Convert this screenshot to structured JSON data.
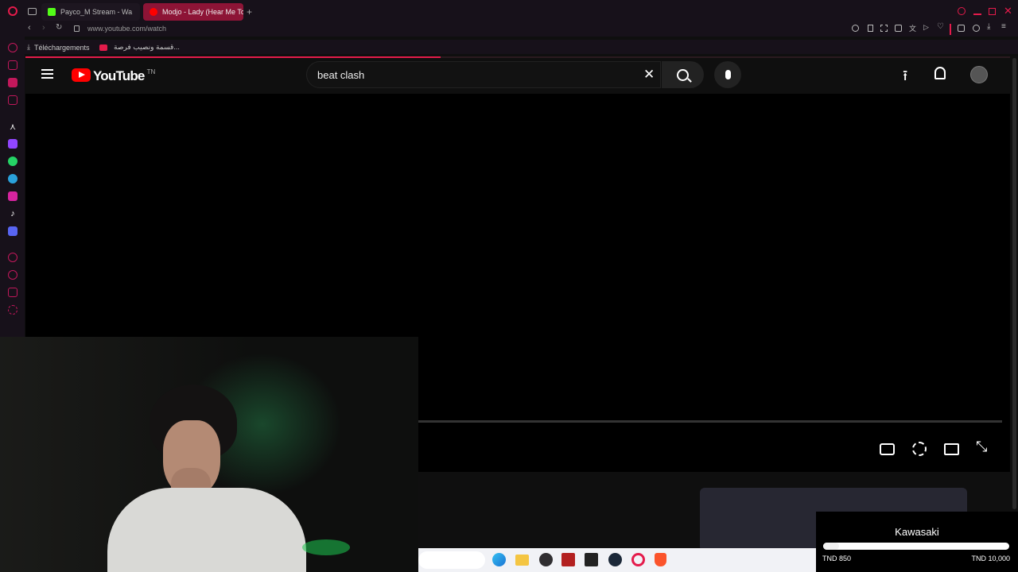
{
  "browser": {
    "tabs": [
      {
        "label": "Payco_M Stream - Wa",
        "icon": "kick-icon",
        "color": "#53fc18"
      },
      {
        "label": "Modjo - Lady (Hear Me To",
        "icon": "youtube-icon",
        "color": "#ff0000",
        "active": true
      }
    ],
    "url": "www.youtube.com/watch",
    "bookmarks": [
      {
        "label": "Téléchargements",
        "icon": "download-icon"
      },
      {
        "label": "قسمة ونصيب فرصة...",
        "icon": "youtube-icon"
      }
    ]
  },
  "youtube": {
    "logo_text": "YouTube",
    "country_code": "TN",
    "search_value": "beat clash"
  },
  "goal_widget": {
    "title": "Kawasaki",
    "current": "TND 850",
    "target": "TND 10,000",
    "progress_fraction": 0.085
  },
  "colors": {
    "accent": "#e41b4b",
    "youtube_red": "#ff0000",
    "kick_green": "#53fc18"
  }
}
